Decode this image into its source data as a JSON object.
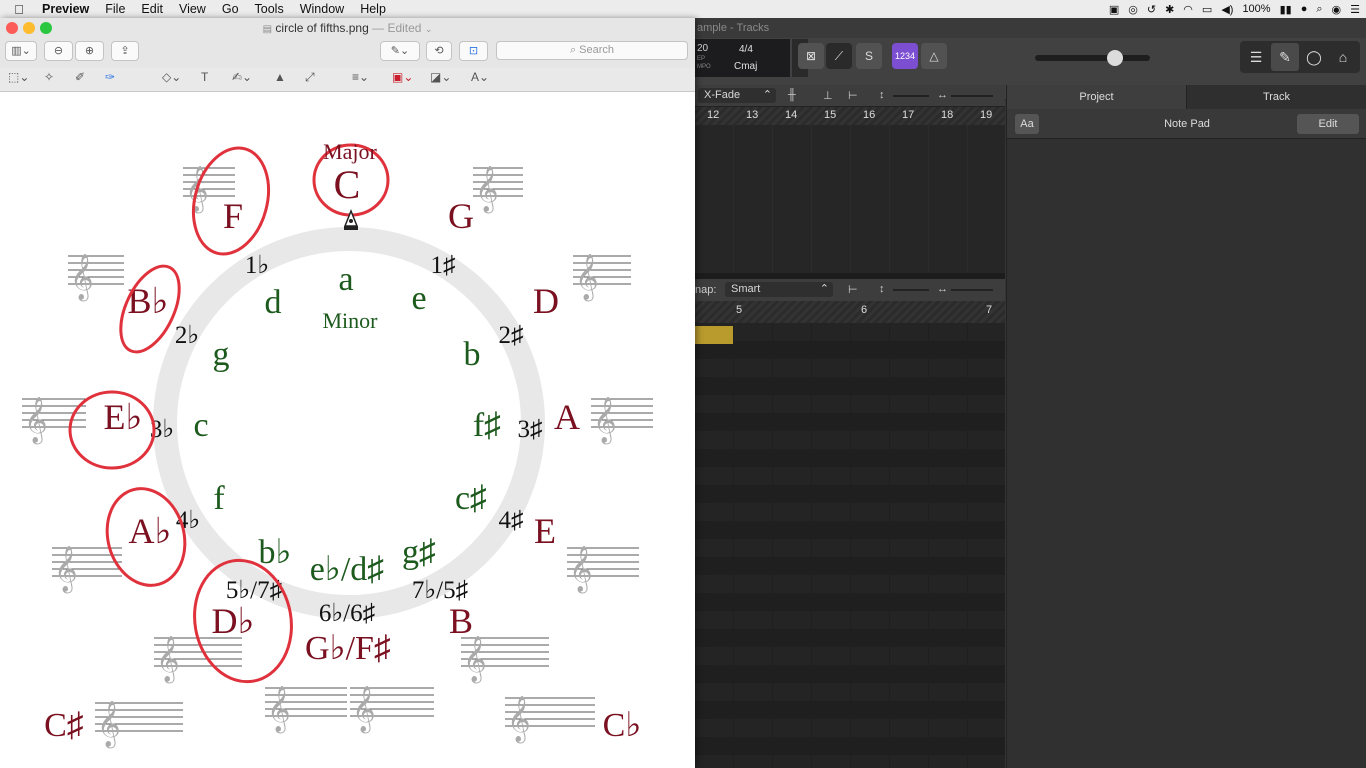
{
  "menubar": {
    "app": "Preview",
    "items": [
      "File",
      "Edit",
      "View",
      "Go",
      "Tools",
      "Window",
      "Help"
    ],
    "battery": "100%"
  },
  "preview": {
    "filename": "circle of fifths.png",
    "edited": "— Edited",
    "search_placeholder": "Search"
  },
  "logic": {
    "title": "ample - Tracks",
    "tempo": "20",
    "tempo_label1": "EP",
    "tempo_label2": "MPO",
    "time_sig": "4/4",
    "key": "Cmaj",
    "count_in": "1234",
    "xfade": "X-Fade",
    "ruler_top": [
      "12",
      "13",
      "14",
      "15",
      "16",
      "17",
      "18",
      "19"
    ],
    "snap_label": "nap:",
    "snap_value": "Smart",
    "ruler_bottom": [
      "5",
      "6",
      "7"
    ],
    "notepad": {
      "tab_project": "Project",
      "tab_track": "Track",
      "aa": "Aa",
      "title": "Note Pad",
      "edit": "Edit"
    }
  },
  "diagram": {
    "major_label": "Major",
    "minor_label": "Minor",
    "major_keys": [
      {
        "key": "C",
        "sig": ""
      },
      {
        "key": "G",
        "sig": "1♯"
      },
      {
        "key": "D",
        "sig": "2♯"
      },
      {
        "key": "A",
        "sig": "3♯"
      },
      {
        "key": "E",
        "sig": "4♯"
      },
      {
        "key": "B",
        "sig": "7♭/5♯"
      },
      {
        "key": "G♭/F♯",
        "sig": "6♭/6♯"
      },
      {
        "key": "D♭",
        "sig": "5♭/7♯"
      },
      {
        "key": "A♭",
        "sig": "4♭"
      },
      {
        "key": "E♭",
        "sig": "3♭"
      },
      {
        "key": "B♭",
        "sig": "2♭"
      },
      {
        "key": "F",
        "sig": "1♭"
      }
    ],
    "minor_keys": [
      "a",
      "e",
      "b",
      "f♯",
      "c♯",
      "g♯",
      "e♭/d♯",
      "b♭",
      "f",
      "c",
      "g",
      "d"
    ],
    "outer_keys": [
      "C♯",
      "C♭"
    ],
    "colors": {
      "major": "#7a1020",
      "minor": "#1d5a1d",
      "circle_marks": "#e0323c",
      "ring": "#e6e6e6"
    }
  }
}
